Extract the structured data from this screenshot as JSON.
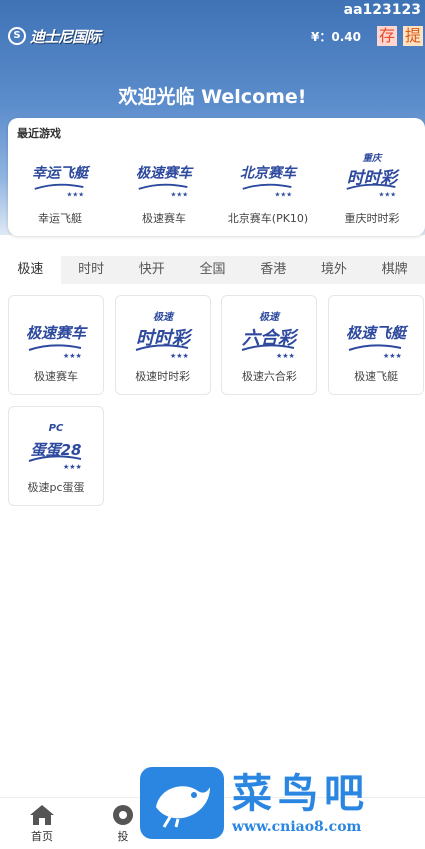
{
  "header": {
    "logo_text": "迪士尼国际",
    "username": "aa123123",
    "balance_prefix": "¥：",
    "balance": "0.40",
    "deposit_label": "存",
    "withdraw_label": "提",
    "welcome": "欢迎光临 Welcome!"
  },
  "recent": {
    "title": "最近游戏",
    "items": [
      {
        "label": "幸运飞艇",
        "art": [
          "幸运飞艇"
        ]
      },
      {
        "label": "极速赛车",
        "art": [
          "极速赛车"
        ]
      },
      {
        "label": "北京赛车(PK10)",
        "art": [
          "北京赛车"
        ]
      },
      {
        "label": "重庆时时彩",
        "art": [
          "重庆",
          "时时彩"
        ]
      }
    ]
  },
  "tabs": [
    "极速",
    "时时",
    "快开",
    "全国",
    "香港",
    "境外",
    "棋牌"
  ],
  "active_tab": "极速",
  "games": [
    {
      "label": "极速赛车",
      "art": [
        "极速赛车"
      ]
    },
    {
      "label": "极速时时彩",
      "art": [
        "极速",
        "时时彩"
      ]
    },
    {
      "label": "极速六合彩",
      "art": [
        "极速",
        "六合彩"
      ]
    },
    {
      "label": "极速飞艇",
      "art": [
        "极速飞艇"
      ]
    },
    {
      "label": "极速pc蛋蛋",
      "art": [
        "PC",
        "蛋蛋28"
      ]
    }
  ],
  "bottom_nav": [
    {
      "label": "首页",
      "icon": "home-icon"
    },
    {
      "label": "投",
      "icon": "bet-icon"
    }
  ],
  "watermark": {
    "title": "菜鸟吧",
    "url": "www.cniao8.com"
  },
  "colors": {
    "header_top": "#3f73b6",
    "art_blue": "#2e4a9e",
    "accent_red": "#e84b2c",
    "watermark_blue": "#2a86e0"
  }
}
